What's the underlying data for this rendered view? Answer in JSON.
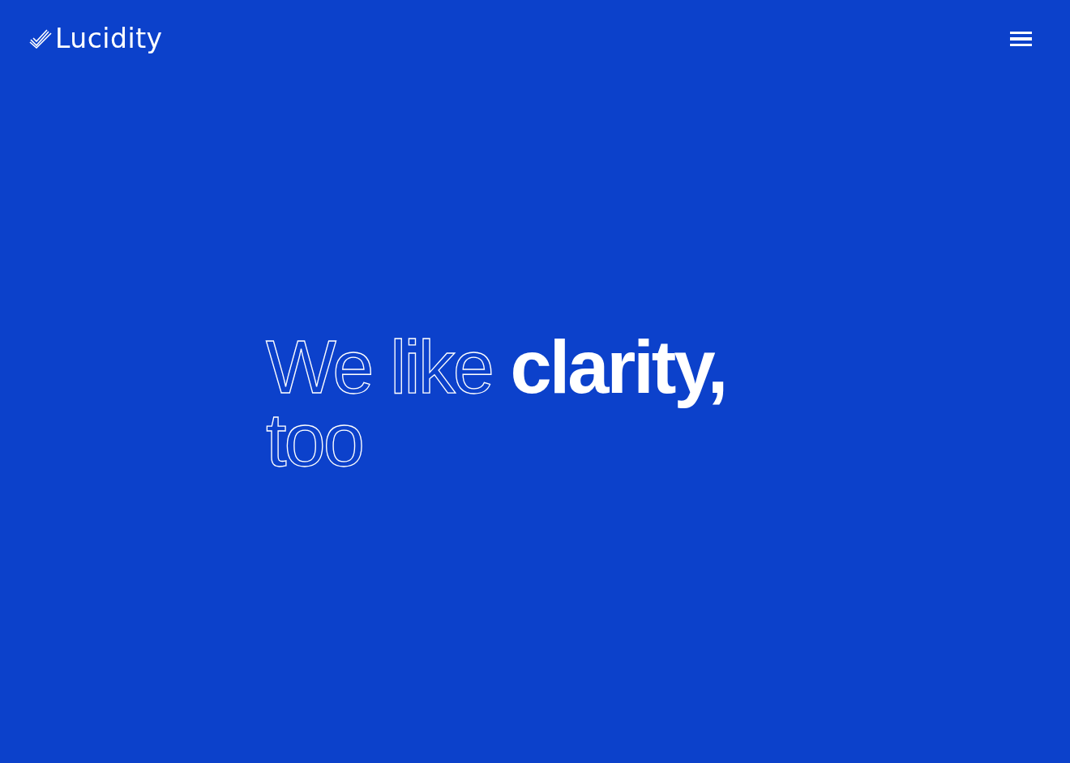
{
  "header": {
    "logo": "Lucidity"
  },
  "headline": {
    "segments": [
      {
        "text": "We like",
        "kind": "outline"
      },
      {
        "text": "clarity,",
        "kind": "solid"
      },
      {
        "text": "too",
        "kind": "outline",
        "line_break_before": true
      }
    ]
  }
}
